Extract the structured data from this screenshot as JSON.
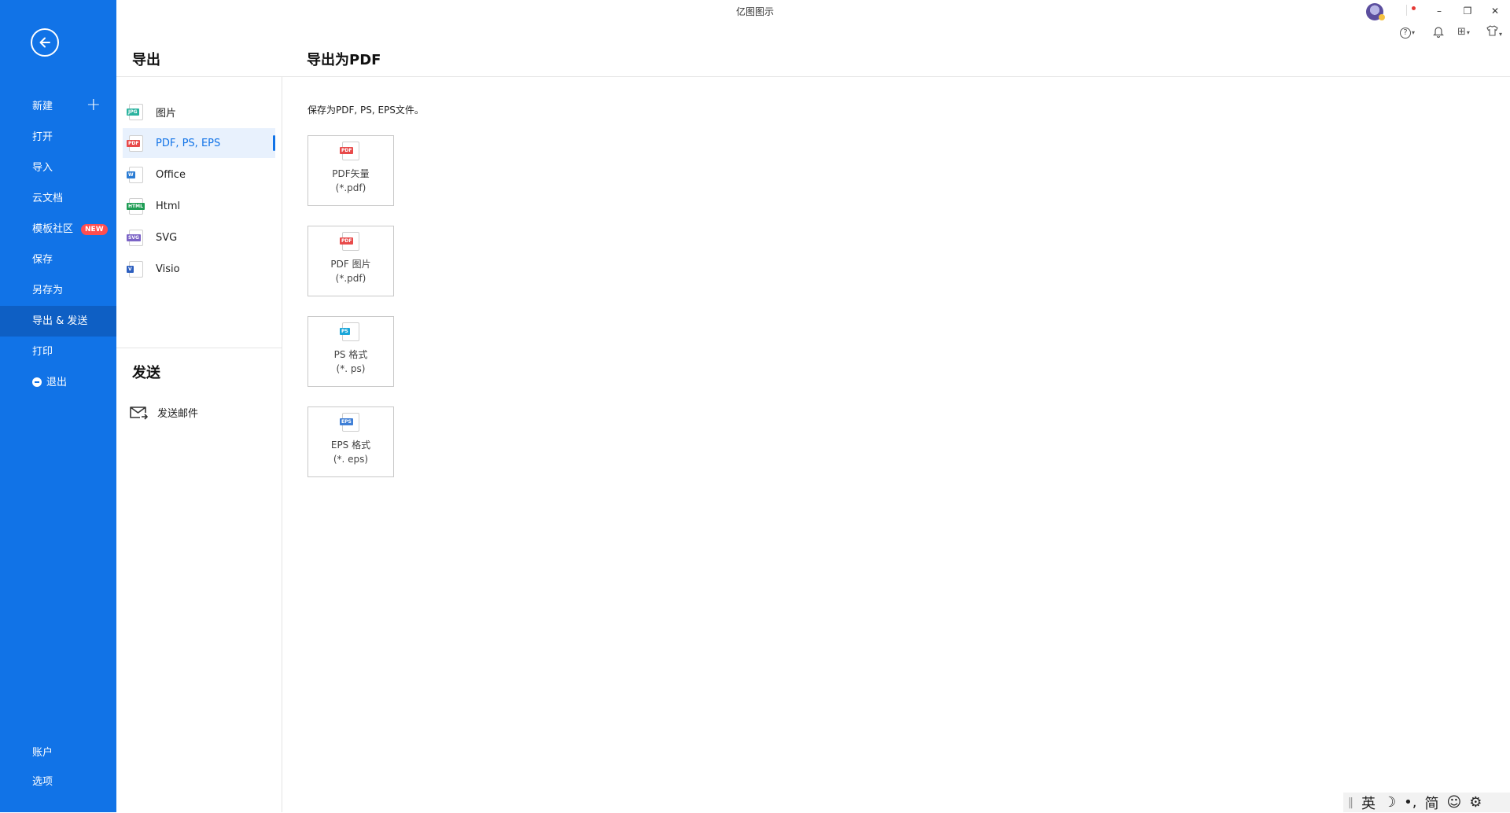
{
  "window": {
    "title": "亿图图示",
    "minimize": "–",
    "restore": "❐",
    "close": "✕"
  },
  "toolbar": {
    "help": "?",
    "bell": "🔔",
    "apps": "⊞",
    "shirt": "👕",
    "caret": "▾"
  },
  "sidebar": {
    "items": [
      {
        "label": "新建"
      },
      {
        "label": "打开"
      },
      {
        "label": "导入"
      },
      {
        "label": "云文档"
      },
      {
        "label": "模板社区",
        "badge": "NEW"
      },
      {
        "label": "保存"
      },
      {
        "label": "另存为"
      },
      {
        "label": "导出 & 发送"
      },
      {
        "label": "打印"
      },
      {
        "label": "退出"
      }
    ],
    "bottom": [
      {
        "label": "账户"
      },
      {
        "label": "选项"
      }
    ]
  },
  "export_panel": {
    "title": "导出",
    "formats": [
      {
        "label": "图片",
        "tag": "JPG",
        "color": "#2bb39f"
      },
      {
        "label": "PDF, PS, EPS",
        "tag": "PDF",
        "color": "#e84a4a"
      },
      {
        "label": "Office",
        "tag": "W",
        "color": "#2b7cd3"
      },
      {
        "label": "Html",
        "tag": "HTML",
        "color": "#1f9d55"
      },
      {
        "label": "SVG",
        "tag": "SVG",
        "color": "#7b63c6"
      },
      {
        "label": "Visio",
        "tag": "V",
        "color": "#2d5fbf"
      }
    ],
    "send_title": "发送",
    "send_items": [
      {
        "label": "发送邮件"
      }
    ]
  },
  "content": {
    "title": "导出为PDF",
    "description": "保存为PDF, PS, EPS文件。",
    "cards": [
      {
        "line1": "PDF矢量",
        "line2": "(*.pdf)",
        "tag": "PDF",
        "color": "#e84a4a"
      },
      {
        "line1": "PDF 图片",
        "line2": "(*.pdf)",
        "tag": "PDF",
        "color": "#e84a4a"
      },
      {
        "line1": "PS 格式",
        "line2": "(*. ps)",
        "tag": "PS",
        "color": "#1aa6d9"
      },
      {
        "line1": "EPS 格式",
        "line2": "(*. eps)",
        "tag": "EPS",
        "color": "#3f7fd6"
      }
    ]
  },
  "ime": {
    "items": [
      "英",
      "☽",
      "•,",
      "简",
      "☺",
      "⚙"
    ]
  }
}
